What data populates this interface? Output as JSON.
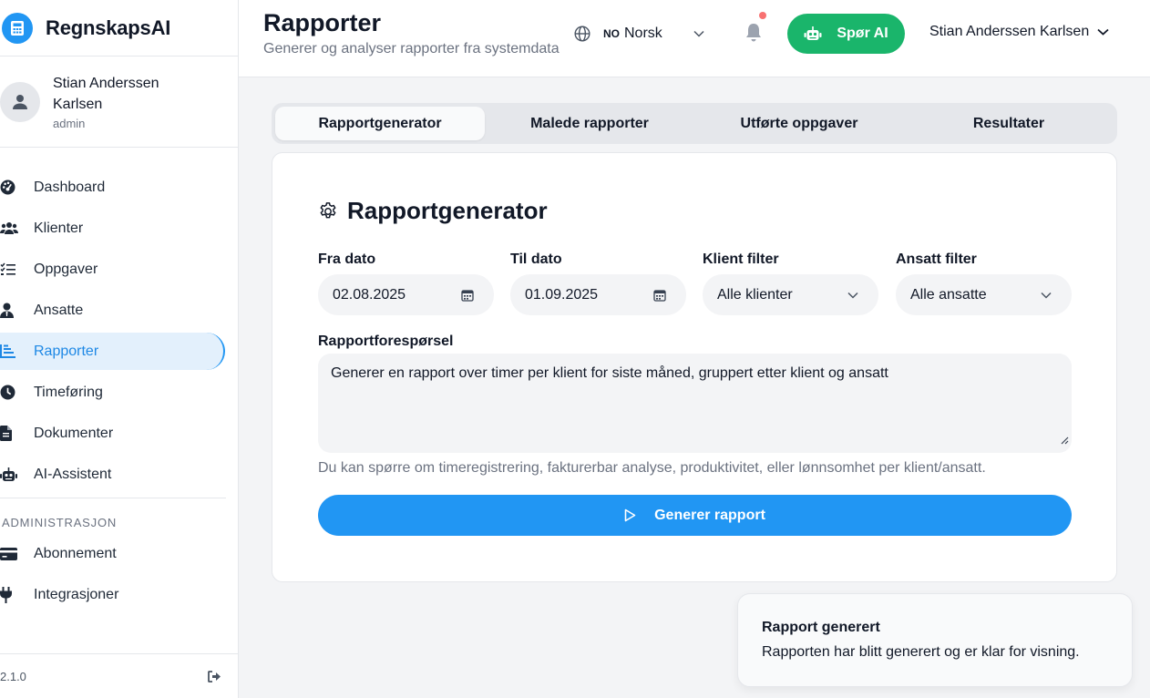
{
  "brand": {
    "name": "RegnskapsAI",
    "logo_icon": "calculator-icon",
    "accent": "#2196f3"
  },
  "user": {
    "name": "Stian Anderssen Karlsen",
    "role": "admin"
  },
  "sidebar": {
    "items": [
      {
        "label": "Dashboard",
        "icon": "dashboard-icon"
      },
      {
        "label": "Klienter",
        "icon": "users-icon"
      },
      {
        "label": "Oppgaver",
        "icon": "tasks-icon"
      },
      {
        "label": "Ansatte",
        "icon": "employee-icon"
      },
      {
        "label": "Rapporter",
        "icon": "chart-icon",
        "active": true
      },
      {
        "label": "Timeføring",
        "icon": "clock-icon"
      },
      {
        "label": "Dokumenter",
        "icon": "document-icon"
      },
      {
        "label": "AI-Assistent",
        "icon": "robot-icon"
      }
    ],
    "admin_section": "ADMINISTRASJON",
    "admin_items": [
      {
        "label": "Abonnement",
        "icon": "credit-card-icon"
      },
      {
        "label": "Integrasjoner",
        "icon": "plug-icon"
      }
    ],
    "version": "2.1.0"
  },
  "header": {
    "title": "Rapporter",
    "subtitle": "Generer og analyser rapporter fra systemdata",
    "language": {
      "code": "NO",
      "name": "Norsk"
    },
    "ask_ai_label": "Spør AI",
    "user_menu_label": "Stian Anderssen Karlsen",
    "ask_ai_color": "#1ab56b",
    "notification_dot_color": "#f87171"
  },
  "tabs": [
    {
      "label": "Rapportgenerator",
      "active": true
    },
    {
      "label": "Malede rapporter"
    },
    {
      "label": "Utførte oppgaver"
    },
    {
      "label": "Resultater"
    }
  ],
  "generator": {
    "title": "Rapportgenerator",
    "fields": {
      "from_date": {
        "label": "Fra dato",
        "value": "02.08.2025"
      },
      "to_date": {
        "label": "Til dato",
        "value": "01.09.2025"
      },
      "client_filter": {
        "label": "Klient filter",
        "value": "Alle klienter"
      },
      "employee_filter": {
        "label": "Ansatt filter",
        "value": "Alle ansatte"
      }
    },
    "request_label": "Rapportforespørsel",
    "request_value": "Generer en rapport over timer per klient for siste måned, gruppert etter klient og ansatt",
    "hint": "Du kan spørre om timeregistrering, fakturerbar analyse, produktivitet, eller lønnsomhet per klient/ansatt.",
    "generate_label": "Generer rapport"
  },
  "toast": {
    "title": "Rapport generert",
    "description": "Rapporten har blitt generert og er klar for visning."
  }
}
